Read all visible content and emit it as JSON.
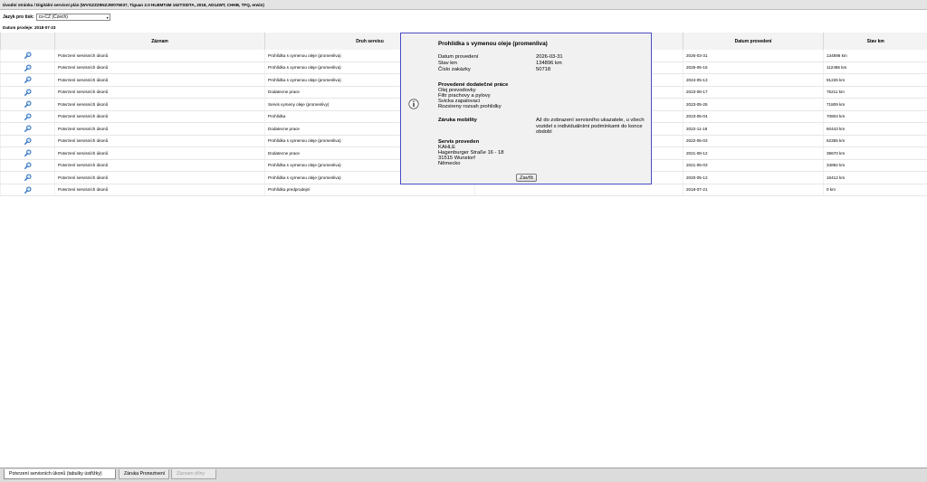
{
  "window": {
    "title": "Úvodní stránka / Digitální servisní plán (WVGZZZ5NZJW076037, Tiguan 2.0 HLBMT4M 162TSIDTA, 2018, AD14WT, CHHB, TFQ, erwin)"
  },
  "language": {
    "label": "Jazyk pro tisk:",
    "selected": "cs-CZ (Czech)"
  },
  "sale_date": {
    "label": "Datum prodeje:",
    "value": "2018-07-23"
  },
  "table": {
    "columns": [
      "Záznam",
      "Druh servisu",
      "",
      "Datum provedení",
      "Stav km"
    ],
    "rows": [
      {
        "record": "Potvrzení servisních úkonů",
        "type": "Prohlídka s vymenou oleje (promenliva)",
        "date": "2026-03-31",
        "km": "134896 km"
      },
      {
        "record": "Potvrzení servisních úkonů",
        "type": "Prohlídka s vymenou oleje (promenliva)",
        "date": "2025-05-15",
        "km": "112485 km"
      },
      {
        "record": "Potvrzení servisních úkonů",
        "type": "Prohlídka s vymenou oleje (promenliva)",
        "date": "2024-05-13",
        "km": "91226 km"
      },
      {
        "record": "Potvrzení servisních úkonů",
        "type": "Dodatecne prace",
        "date": "2023-08-17",
        "km": "75211 km"
      },
      {
        "record": "Potvrzení servisních úkonů",
        "type": "Servis vymeny oleje (promenlivy)",
        "date": "2023-05-25",
        "km": "71809 km"
      },
      {
        "record": "Potvrzení servisních úkonů",
        "type": "Prohlídka",
        "date": "2023-05-04",
        "km": "70804 km"
      },
      {
        "record": "Potvrzení servisních úkonů",
        "type": "Dodatecne prace",
        "date": "2022-11-18",
        "km": "60443 km"
      },
      {
        "record": "Potvrzení servisních úkonů",
        "type": "Prohlídka s vymenou oleje (promenliva)",
        "date": "2022-05-03",
        "km": "52355 km"
      },
      {
        "record": "Potvrzení servisních úkonů",
        "type": "Dodatecne prace",
        "date": "2021-08-12",
        "km": "39670 km"
      },
      {
        "record": "Potvrzení servisních úkonů",
        "type": "Prohlídka s vymenou oleje (promenliva)",
        "date": "2021-05-03",
        "km": "34892 km"
      },
      {
        "record": "Potvrzení servisních úkonů",
        "type": "Prohlídka s vymenou oleje (promenliva)",
        "date": "2020-05-12",
        "km": "16412 km"
      },
      {
        "record": "Potvrzení servisních úkonů",
        "type": "Prohlídka predprodejní",
        "date": "2018-07-21",
        "km": "0 km"
      }
    ]
  },
  "popup": {
    "title": "Prohlídka s vymenou oleje (promenliva)",
    "fields": [
      {
        "label": "Datum provedení",
        "value": "2026-03-31"
      },
      {
        "label": "Stav km",
        "value": "134896 km"
      },
      {
        "label": "Číslo zakázky",
        "value": "50718"
      }
    ],
    "extra_work": {
      "heading": "Provedené dodatečné práce",
      "items": [
        "Olej prevodovky",
        "Filtr prachovy a pylovy",
        "Svicka zapalovaci",
        "Rozsireny rozsah prohlidky"
      ]
    },
    "mobility": {
      "label": "Záruka mobility",
      "text": "Až do zobrazení servisního ukazatele, u všech vozidel s individuálními podmínkami do konce období"
    },
    "service": {
      "heading": "Servis proveden",
      "lines": [
        "KAHLE",
        "Hagenburger Straße 16 - 18",
        "31515 Wunstorf",
        "Německo"
      ]
    },
    "close_label": "Zavřít"
  },
  "tabs": [
    "Potvrzení servisních úkonů (tabulky ústřižky)",
    "Záruka Proneztvení",
    "Záznam dílny"
  ],
  "icons": {
    "row_action": "magnifier-icon",
    "popup_info": "info-icon",
    "lang_arrow": "chevron-down-icon"
  },
  "colors": {
    "popup_border": "#4b4dc4",
    "icon_blue": "#2a6fbf"
  }
}
